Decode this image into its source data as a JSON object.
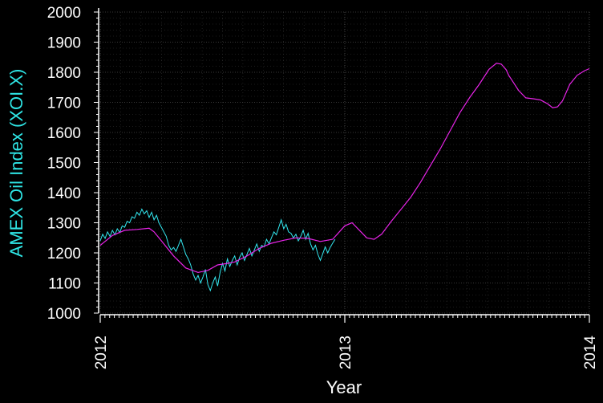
{
  "colors": {
    "background": "#000000",
    "axis": "#ffffff",
    "grid": "#6e6e6e",
    "ylabel": "#2fe6e6",
    "daily_series": "#33e8f0",
    "smoothed_series": "#e824e8"
  },
  "chart_data": {
    "type": "line",
    "title": "",
    "xlabel": "Year",
    "ylabel": "AMEX Oil Index (XOI.X)",
    "xlim": [
      2012,
      2014
    ],
    "ylim": [
      1000,
      2000
    ],
    "xticks": [
      "2012",
      "2013",
      "2014"
    ],
    "yticks": [
      "1000",
      "1100",
      "1200",
      "1300",
      "1400",
      "1500",
      "1600",
      "1700",
      "1800",
      "1900",
      "2000"
    ],
    "grid": true,
    "legend": "none",
    "series": [
      {
        "key": "daily",
        "color": "#33e8f0",
        "x": [
          2012.0,
          2012.01,
          2012.02,
          2012.03,
          2012.04,
          2012.05,
          2012.06,
          2012.07,
          2012.08,
          2012.09,
          2012.1,
          2012.11,
          2012.12,
          2012.13,
          2012.14,
          2012.15,
          2012.16,
          2012.17,
          2012.18,
          2012.19,
          2012.2,
          2012.21,
          2012.22,
          2012.23,
          2012.24,
          2012.25,
          2012.26,
          2012.27,
          2012.28,
          2012.29,
          2012.3,
          2012.31,
          2012.32,
          2012.33,
          2012.34,
          2012.35,
          2012.36,
          2012.37,
          2012.38,
          2012.39,
          2012.4,
          2012.41,
          2012.42,
          2012.43,
          2012.44,
          2012.45,
          2012.46,
          2012.47,
          2012.48,
          2012.49,
          2012.5,
          2012.51,
          2012.52,
          2012.53,
          2012.54,
          2012.55,
          2012.56,
          2012.57,
          2012.58,
          2012.59,
          2012.6,
          2012.61,
          2012.62,
          2012.63,
          2012.64,
          2012.65,
          2012.66,
          2012.67,
          2012.68,
          2012.69,
          2012.7,
          2012.71,
          2012.72,
          2012.73,
          2012.74,
          2012.75,
          2012.76,
          2012.77,
          2012.78,
          2012.79,
          2012.8,
          2012.81,
          2012.82,
          2012.83,
          2012.84,
          2012.85,
          2012.86,
          2012.87,
          2012.88,
          2012.89,
          2012.9,
          2012.91,
          2012.92,
          2012.93,
          2012.94,
          2012.95,
          2012.96
        ],
        "y": [
          1240,
          1262,
          1248,
          1270,
          1255,
          1275,
          1260,
          1280,
          1268,
          1290,
          1285,
          1305,
          1300,
          1320,
          1315,
          1335,
          1325,
          1345,
          1330,
          1340,
          1318,
          1335,
          1310,
          1325,
          1300,
          1285,
          1270,
          1255,
          1225,
          1210,
          1218,
          1205,
          1225,
          1245,
          1220,
          1195,
          1180,
          1160,
          1130,
          1110,
          1125,
          1100,
          1120,
          1145,
          1095,
          1075,
          1100,
          1120,
          1090,
          1135,
          1165,
          1140,
          1180,
          1155,
          1175,
          1190,
          1160,
          1185,
          1200,
          1175,
          1195,
          1215,
          1190,
          1210,
          1230,
          1205,
          1225,
          1220,
          1245,
          1230,
          1250,
          1270,
          1260,
          1285,
          1310,
          1280,
          1295,
          1270,
          1265,
          1250,
          1262,
          1240,
          1255,
          1275,
          1245,
          1265,
          1230,
          1210,
          1225,
          1195,
          1175,
          1198,
          1220,
          1200,
          1218,
          1232,
          1245
        ]
      },
      {
        "key": "smoothed",
        "color": "#e824e8",
        "x": [
          2012.0,
          2012.05,
          2012.1,
          2012.15,
          2012.2,
          2012.22,
          2012.25,
          2012.3,
          2012.35,
          2012.4,
          2012.44,
          2012.48,
          2012.52,
          2012.55,
          2012.6,
          2012.65,
          2012.7,
          2012.75,
          2012.8,
          2012.85,
          2012.9,
          2012.95,
          2013.0,
          2013.03,
          2013.06,
          2013.09,
          2013.12,
          2013.15,
          2013.19,
          2013.23,
          2013.27,
          2013.31,
          2013.35,
          2013.39,
          2013.43,
          2013.47,
          2013.51,
          2013.55,
          2013.59,
          2013.62,
          2013.64,
          2013.66,
          2013.67,
          2013.69,
          2013.71,
          2013.74,
          2013.77,
          2013.8,
          2013.83,
          2013.85,
          2013.87,
          2013.89,
          2013.92,
          2013.95,
          2013.98,
          2014.0
        ],
        "y": [
          1225,
          1258,
          1275,
          1278,
          1282,
          1270,
          1240,
          1190,
          1150,
          1135,
          1142,
          1160,
          1165,
          1170,
          1190,
          1215,
          1232,
          1242,
          1250,
          1248,
          1238,
          1245,
          1290,
          1300,
          1275,
          1250,
          1245,
          1262,
          1305,
          1345,
          1385,
          1435,
          1490,
          1545,
          1605,
          1665,
          1715,
          1760,
          1810,
          1830,
          1827,
          1808,
          1790,
          1765,
          1740,
          1715,
          1712,
          1708,
          1695,
          1682,
          1685,
          1705,
          1760,
          1790,
          1805,
          1812
        ]
      }
    ]
  }
}
